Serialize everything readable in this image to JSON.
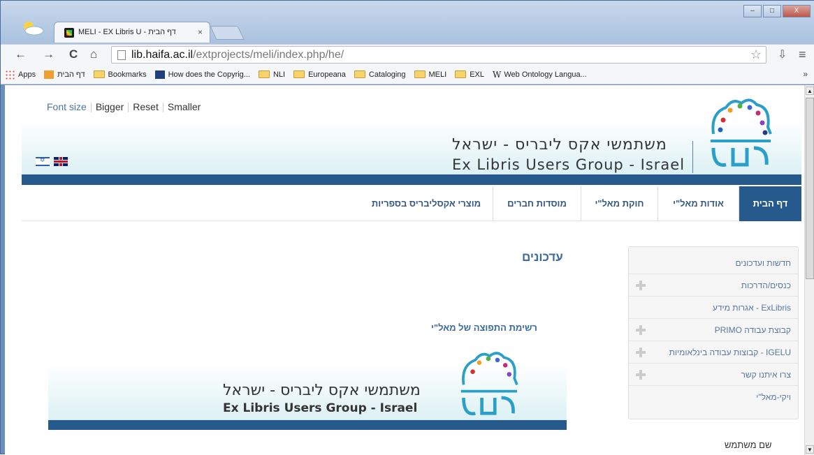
{
  "browser": {
    "tab_title": "MELI - EX Libris U - דף הבית",
    "tab_close": "×",
    "url_host": "lib.haifa.ac.il",
    "url_path": "/extprojects/meli/index.php/he/",
    "window_buttons": {
      "minimize": "–",
      "maximize": "□",
      "close": "X"
    },
    "nav": {
      "back": "←",
      "forward": "→",
      "reload": "C",
      "home": "⌂"
    },
    "star": "☆",
    "menu_icon": "≡",
    "ext_icon": "⇩",
    "bookmarks": [
      {
        "label": "Apps",
        "icon": "apps-icon"
      },
      {
        "label": "דף הבית",
        "icon": "site-icon"
      },
      {
        "label": "Bookmarks",
        "icon": "folder-icon"
      },
      {
        "label": "How does the Copyrig...",
        "icon": "bookmark-icon"
      },
      {
        "label": "NLI",
        "icon": "folder-icon"
      },
      {
        "label": "Europeana",
        "icon": "folder-icon"
      },
      {
        "label": "Cataloging",
        "icon": "folder-icon"
      },
      {
        "label": "MELI",
        "icon": "folder-icon"
      },
      {
        "label": "EXL",
        "icon": "folder-icon"
      },
      {
        "label": "Web Ontology Langua...",
        "icon": "wikipedia-icon"
      }
    ],
    "bookmarks_more": "»"
  },
  "header": {
    "font_size_label": "Font size",
    "bigger": "Bigger",
    "reset": "Reset",
    "smaller": "Smaller",
    "title_he": "משתמשי אקס ליבריס - ישראל",
    "title_en": "Ex Libris Users Group - Israel"
  },
  "menu": [
    {
      "label": "דף הבית",
      "active": true
    },
    {
      "label": "אודות מאל\"י"
    },
    {
      "label": "חוקת מאל\"י"
    },
    {
      "label": "מוסדות חברים"
    },
    {
      "label": "מוצרי אקסליבריס בספריות"
    }
  ],
  "sidebar": [
    {
      "label": "חדשות ועדכונים",
      "expandable": false
    },
    {
      "label": "כנסים/הדרכות",
      "expandable": true
    },
    {
      "label": "ExLibris - אגרות מידע",
      "expandable": false
    },
    {
      "label": "קבוצת עבודה PRIMO",
      "expandable": true
    },
    {
      "label": "IGELU - קבוצות עבודה בינלאומיות",
      "expandable": true
    },
    {
      "label": "צרו איתנו קשר",
      "expandable": true
    },
    {
      "label": "ויקי-מאל\"י",
      "expandable": false
    }
  ],
  "main": {
    "title": "עדכונים",
    "team_list_title": "רשימת התפוצה של מאל\"י",
    "banner_he": "משתמשי אקס ליבריס - ישראל",
    "banner_en": "Ex Libris Users Group - Israel"
  },
  "login": {
    "username_label": "שם משתמש"
  },
  "colors": {
    "brand_blue": "#275a8c",
    "link_blue": "#3a6a9e"
  }
}
